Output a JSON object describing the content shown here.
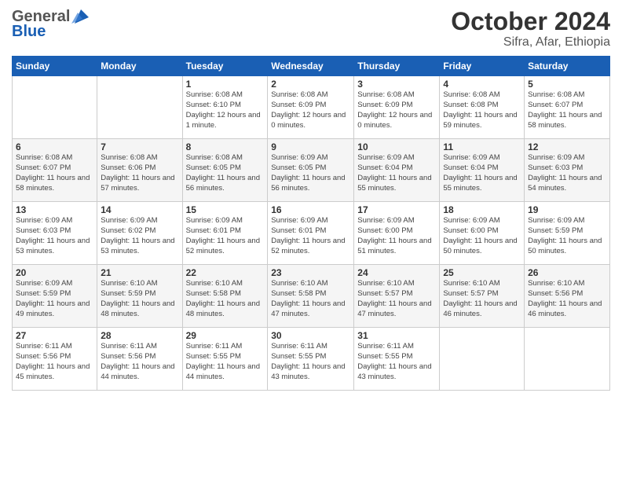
{
  "logo": {
    "general": "General",
    "blue": "Blue"
  },
  "header": {
    "month": "October 2024",
    "location": "Sifra, Afar, Ethiopia"
  },
  "weekdays": [
    "Sunday",
    "Monday",
    "Tuesday",
    "Wednesday",
    "Thursday",
    "Friday",
    "Saturday"
  ],
  "weeks": [
    [
      {
        "day": "",
        "sunrise": "",
        "sunset": "",
        "daylight": ""
      },
      {
        "day": "",
        "sunrise": "",
        "sunset": "",
        "daylight": ""
      },
      {
        "day": "1",
        "sunrise": "Sunrise: 6:08 AM",
        "sunset": "Sunset: 6:10 PM",
        "daylight": "Daylight: 12 hours and 1 minute."
      },
      {
        "day": "2",
        "sunrise": "Sunrise: 6:08 AM",
        "sunset": "Sunset: 6:09 PM",
        "daylight": "Daylight: 12 hours and 0 minutes."
      },
      {
        "day": "3",
        "sunrise": "Sunrise: 6:08 AM",
        "sunset": "Sunset: 6:09 PM",
        "daylight": "Daylight: 12 hours and 0 minutes."
      },
      {
        "day": "4",
        "sunrise": "Sunrise: 6:08 AM",
        "sunset": "Sunset: 6:08 PM",
        "daylight": "Daylight: 11 hours and 59 minutes."
      },
      {
        "day": "5",
        "sunrise": "Sunrise: 6:08 AM",
        "sunset": "Sunset: 6:07 PM",
        "daylight": "Daylight: 11 hours and 58 minutes."
      }
    ],
    [
      {
        "day": "6",
        "sunrise": "Sunrise: 6:08 AM",
        "sunset": "Sunset: 6:07 PM",
        "daylight": "Daylight: 11 hours and 58 minutes."
      },
      {
        "day": "7",
        "sunrise": "Sunrise: 6:08 AM",
        "sunset": "Sunset: 6:06 PM",
        "daylight": "Daylight: 11 hours and 57 minutes."
      },
      {
        "day": "8",
        "sunrise": "Sunrise: 6:08 AM",
        "sunset": "Sunset: 6:05 PM",
        "daylight": "Daylight: 11 hours and 56 minutes."
      },
      {
        "day": "9",
        "sunrise": "Sunrise: 6:09 AM",
        "sunset": "Sunset: 6:05 PM",
        "daylight": "Daylight: 11 hours and 56 minutes."
      },
      {
        "day": "10",
        "sunrise": "Sunrise: 6:09 AM",
        "sunset": "Sunset: 6:04 PM",
        "daylight": "Daylight: 11 hours and 55 minutes."
      },
      {
        "day": "11",
        "sunrise": "Sunrise: 6:09 AM",
        "sunset": "Sunset: 6:04 PM",
        "daylight": "Daylight: 11 hours and 55 minutes."
      },
      {
        "day": "12",
        "sunrise": "Sunrise: 6:09 AM",
        "sunset": "Sunset: 6:03 PM",
        "daylight": "Daylight: 11 hours and 54 minutes."
      }
    ],
    [
      {
        "day": "13",
        "sunrise": "Sunrise: 6:09 AM",
        "sunset": "Sunset: 6:03 PM",
        "daylight": "Daylight: 11 hours and 53 minutes."
      },
      {
        "day": "14",
        "sunrise": "Sunrise: 6:09 AM",
        "sunset": "Sunset: 6:02 PM",
        "daylight": "Daylight: 11 hours and 53 minutes."
      },
      {
        "day": "15",
        "sunrise": "Sunrise: 6:09 AM",
        "sunset": "Sunset: 6:01 PM",
        "daylight": "Daylight: 11 hours and 52 minutes."
      },
      {
        "day": "16",
        "sunrise": "Sunrise: 6:09 AM",
        "sunset": "Sunset: 6:01 PM",
        "daylight": "Daylight: 11 hours and 52 minutes."
      },
      {
        "day": "17",
        "sunrise": "Sunrise: 6:09 AM",
        "sunset": "Sunset: 6:00 PM",
        "daylight": "Daylight: 11 hours and 51 minutes."
      },
      {
        "day": "18",
        "sunrise": "Sunrise: 6:09 AM",
        "sunset": "Sunset: 6:00 PM",
        "daylight": "Daylight: 11 hours and 50 minutes."
      },
      {
        "day": "19",
        "sunrise": "Sunrise: 6:09 AM",
        "sunset": "Sunset: 5:59 PM",
        "daylight": "Daylight: 11 hours and 50 minutes."
      }
    ],
    [
      {
        "day": "20",
        "sunrise": "Sunrise: 6:09 AM",
        "sunset": "Sunset: 5:59 PM",
        "daylight": "Daylight: 11 hours and 49 minutes."
      },
      {
        "day": "21",
        "sunrise": "Sunrise: 6:10 AM",
        "sunset": "Sunset: 5:59 PM",
        "daylight": "Daylight: 11 hours and 48 minutes."
      },
      {
        "day": "22",
        "sunrise": "Sunrise: 6:10 AM",
        "sunset": "Sunset: 5:58 PM",
        "daylight": "Daylight: 11 hours and 48 minutes."
      },
      {
        "day": "23",
        "sunrise": "Sunrise: 6:10 AM",
        "sunset": "Sunset: 5:58 PM",
        "daylight": "Daylight: 11 hours and 47 minutes."
      },
      {
        "day": "24",
        "sunrise": "Sunrise: 6:10 AM",
        "sunset": "Sunset: 5:57 PM",
        "daylight": "Daylight: 11 hours and 47 minutes."
      },
      {
        "day": "25",
        "sunrise": "Sunrise: 6:10 AM",
        "sunset": "Sunset: 5:57 PM",
        "daylight": "Daylight: 11 hours and 46 minutes."
      },
      {
        "day": "26",
        "sunrise": "Sunrise: 6:10 AM",
        "sunset": "Sunset: 5:56 PM",
        "daylight": "Daylight: 11 hours and 46 minutes."
      }
    ],
    [
      {
        "day": "27",
        "sunrise": "Sunrise: 6:11 AM",
        "sunset": "Sunset: 5:56 PM",
        "daylight": "Daylight: 11 hours and 45 minutes."
      },
      {
        "day": "28",
        "sunrise": "Sunrise: 6:11 AM",
        "sunset": "Sunset: 5:56 PM",
        "daylight": "Daylight: 11 hours and 44 minutes."
      },
      {
        "day": "29",
        "sunrise": "Sunrise: 6:11 AM",
        "sunset": "Sunset: 5:55 PM",
        "daylight": "Daylight: 11 hours and 44 minutes."
      },
      {
        "day": "30",
        "sunrise": "Sunrise: 6:11 AM",
        "sunset": "Sunset: 5:55 PM",
        "daylight": "Daylight: 11 hours and 43 minutes."
      },
      {
        "day": "31",
        "sunrise": "Sunrise: 6:11 AM",
        "sunset": "Sunset: 5:55 PM",
        "daylight": "Daylight: 11 hours and 43 minutes."
      },
      {
        "day": "",
        "sunrise": "",
        "sunset": "",
        "daylight": ""
      },
      {
        "day": "",
        "sunrise": "",
        "sunset": "",
        "daylight": ""
      }
    ]
  ]
}
